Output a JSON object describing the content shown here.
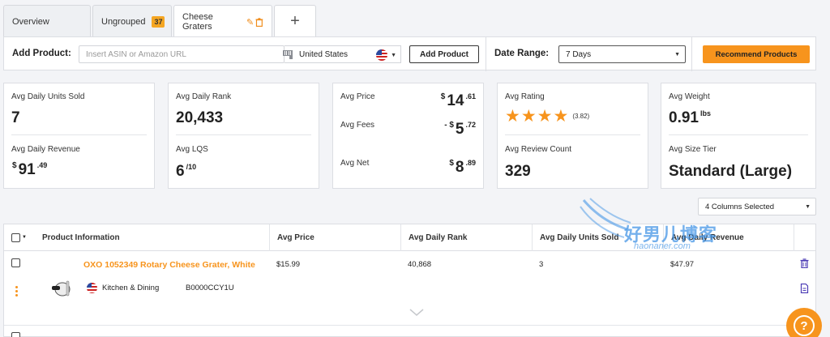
{
  "tabs": [
    {
      "label": "Overview"
    },
    {
      "label": "Ungrouped",
      "badge": "37"
    },
    {
      "label": "Cheese Graters"
    }
  ],
  "toolbar": {
    "add_label": "Add Product:",
    "asin_placeholder": "Insert ASIN or Amazon URL",
    "country": "United States",
    "add_button": "Add Product",
    "date_label": "Date Range:",
    "date_value": "7 Days",
    "recommend_button": "Recommend Products"
  },
  "cards": {
    "units_label": "Avg Daily Units Sold",
    "units_value": "7",
    "revenue_label": "Avg Daily Revenue",
    "revenue": {
      "cur": "$",
      "int": "91",
      "dec": ".49"
    },
    "rank_label": "Avg Daily Rank",
    "rank_value": "20,433",
    "lqs_label": "Avg LQS",
    "lqs_value": "6",
    "lqs_suffix": "/10",
    "price_label": "Avg Price",
    "price": {
      "cur": "$",
      "int": "14",
      "dec": ".61"
    },
    "fees_label": "Avg Fees",
    "fees": {
      "cur": "- $",
      "int": "5",
      "dec": ".72"
    },
    "net_label": "Avg Net",
    "net": {
      "cur": "$",
      "int": "8",
      "dec": ".89"
    },
    "rating_label": "Avg Rating",
    "rating_stars": 4,
    "rating_value": "(3.82)",
    "review_label": "Avg Review Count",
    "review_value": "329",
    "weight_label": "Avg Weight",
    "weight_value": "0.91",
    "weight_unit": "lbs",
    "size_label": "Avg Size Tier",
    "size_value": "Standard (Large)"
  },
  "columns_select": "4 Columns Selected",
  "table": {
    "headers": [
      "Product Information",
      "Avg Price",
      "Avg Daily Rank",
      "Avg Daily Units Sold",
      "Avg Daily Revenue"
    ],
    "rows": [
      {
        "title": "OXO 1052349 Rotary Cheese Grater, White",
        "category": "Kitchen & Dining",
        "asin": "B0000CCY1U",
        "price": "$15.99",
        "rank": "40,868",
        "units": "3",
        "revenue": "$47.97"
      }
    ]
  },
  "watermark": {
    "title": "好男儿博客",
    "sub": "haonaner.com"
  },
  "colors": {
    "accent": "#f7941d",
    "badge": "#f5a623"
  }
}
